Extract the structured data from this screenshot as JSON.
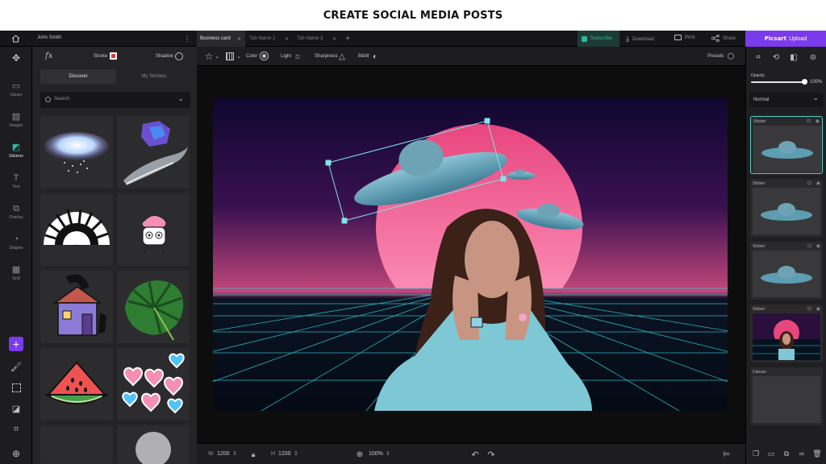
{
  "banner": {
    "title": "CREATE SOCIAL MEDIA POSTS"
  },
  "topbar": {
    "user": "John Smith",
    "tabs": [
      "Business card",
      "Tab Name 2",
      "Tab Name 3"
    ],
    "subscribe": "Subscribe",
    "download": "Download",
    "print": "Print",
    "share": "Share",
    "brand": "Picsart",
    "upload": "Upload"
  },
  "rail": {
    "items": [
      {
        "label": "Library",
        "icon": "library-icon"
      },
      {
        "label": "Images",
        "icon": "images-icon"
      },
      {
        "label": "Stickers",
        "icon": "stickers-icon"
      },
      {
        "label": "Text",
        "icon": "text-icon"
      },
      {
        "label": "Overlay",
        "icon": "overlay-icon"
      },
      {
        "label": "Shapes",
        "icon": "shapes-icon"
      },
      {
        "label": "Grid",
        "icon": "grid-icon"
      }
    ],
    "active": "Stickers"
  },
  "panel": {
    "fx": "fx",
    "stroke": "Stroke",
    "shadow": "Shadow",
    "tabs": [
      "Discover",
      "My Stickers"
    ],
    "search_placeholder": "Search"
  },
  "toolbar": {
    "color": "Color",
    "light": "Light",
    "sharpness": "Sharpness",
    "bw": "B&W",
    "presets": "Presets"
  },
  "bottombar": {
    "w_label": "W",
    "w_value": "1200",
    "h_label": "H",
    "h_value": "1200",
    "zoom": "100%"
  },
  "right": {
    "opacity_label": "Opacity",
    "opacity_value": "100%",
    "opacity": 1.0,
    "blend": "Normal",
    "layers": [
      "Sticker",
      "Sticker",
      "Sticker",
      "Sticker",
      "Canvas"
    ]
  },
  "colors": {
    "accent": "#7c3aed",
    "subscribe": "#2fb7a0",
    "selection": "#7fe3e8"
  }
}
